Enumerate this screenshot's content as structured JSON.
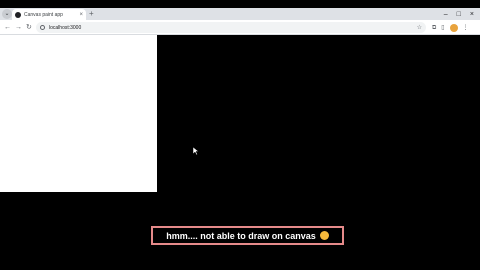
{
  "browser": {
    "tab_title": "Canvas paint app",
    "tab_close": "×",
    "new_tab": "+",
    "url": "localhost:3000",
    "window_controls": {
      "minimize": "–",
      "maximize": "□",
      "close": "×"
    },
    "nav": {
      "back": "←",
      "forward": "→",
      "reload": "↻"
    },
    "star": "☆",
    "toolbar_icons": {
      "extensions": "⧉",
      "menu": "⋮"
    }
  },
  "caption": {
    "text": "hmm.... not able to draw on canvas",
    "emoji": "thinking-face-icon"
  },
  "colors": {
    "caption_border": "#e58a8a",
    "page_background": "#000000",
    "canvas": "#ffffff"
  }
}
